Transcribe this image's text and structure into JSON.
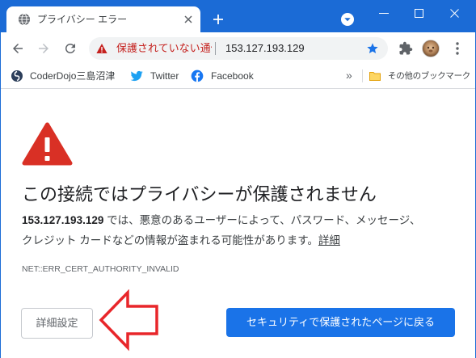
{
  "window": {
    "accent_color": "#1b6bd6",
    "tab": {
      "title": "プライバシー エラー",
      "icon": "globe-icon",
      "close_icon": "close-icon"
    },
    "new_tab_icon": "plus-icon",
    "tab_search_icon": "chevron-down-icon",
    "controls": {
      "minimize_icon": "minimize-icon",
      "maximize_icon": "maximize-icon",
      "close_icon": "close-icon"
    }
  },
  "toolbar": {
    "back_icon": "arrow-left-icon",
    "forward_icon": "arrow-right-icon",
    "reload_icon": "reload-icon",
    "omnibox": {
      "security_icon": "warning-icon",
      "security_text": "保護されていない通信",
      "security_color": "#c5221f",
      "url": "153.127.193.129",
      "bookmark_icon": "star-icon"
    },
    "extensions_icon": "puzzle-icon",
    "profile_icon": "avatar",
    "menu_icon": "more-vert-icon"
  },
  "bookmarks": {
    "items": [
      {
        "label": "CoderDojo三島沼津",
        "icon": "coderdojo-icon"
      },
      {
        "label": "Twitter",
        "icon": "twitter-icon"
      },
      {
        "label": "Facebook",
        "icon": "facebook-icon"
      }
    ],
    "overflow_label": "»",
    "other_bookmarks": {
      "label": "その他のブックマーク",
      "icon": "folder-icon"
    }
  },
  "interstitial": {
    "icon": "warning-icon",
    "icon_color": "#d93025",
    "heading": "この接続ではプライバシーが保護されません",
    "body": {
      "host": "153.127.193.129",
      "line1_rest": " では、悪意のあるユーザーによって、パスワード、メッセージ、",
      "line2": "クレジット カードなどの情報が盗まれる可能性があります。",
      "learn_more_link": "詳細"
    },
    "error_code": "NET::ERR_CERT_AUTHORITY_INVALID",
    "advanced_button": "詳細設定",
    "back_button": "セキュリティで保護されたページに戻る",
    "primary_color": "#1a73e8"
  },
  "annotation": {
    "arrow_color": "#e8262a"
  }
}
